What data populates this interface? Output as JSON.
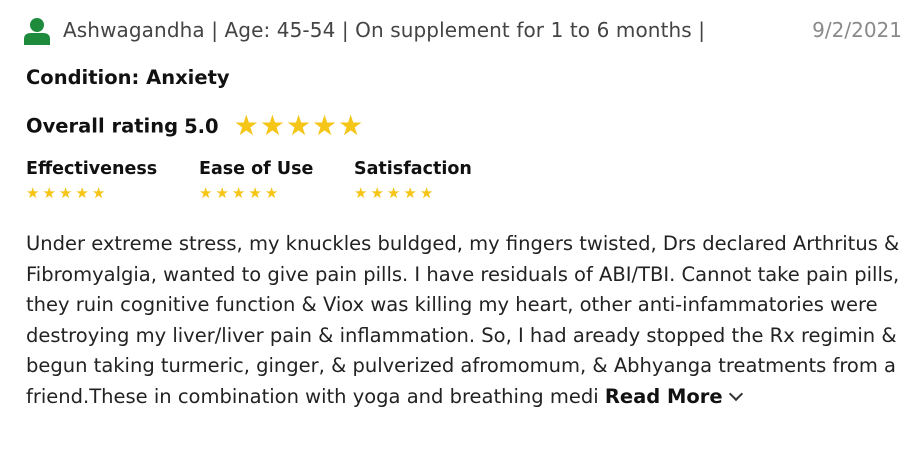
{
  "header": {
    "reviewer_meta": "Ashwagandha | Age: 45-54 | On supplement for 1 to 6 months |",
    "date": "9/2/2021",
    "avatar_color": "#1e8a3c"
  },
  "condition": {
    "label": "Condition:",
    "value": "Anxiety"
  },
  "overall": {
    "label": "Overall rating",
    "value": "5.0",
    "stars": 5,
    "star_color": "#f5c518"
  },
  "sub_ratings": [
    {
      "label": "Effectiveness",
      "stars": 5
    },
    {
      "label": "Ease of Use",
      "stars": 5
    },
    {
      "label": "Satisfaction",
      "stars": 5
    }
  ],
  "review": {
    "text": "Under extreme stress, my knuckles buldged, my fingers twisted, Drs declared Arthritus & Fibromyalgia, wanted to give pain pills. I have residuals of ABI/TBI. Cannot take pain pills, they ruin cognitive function & Viox was killing my heart, other anti-infammatories were destroying my liver/liver pain & inflammation. So, I had aready stopped the Rx regimin & begun taking turmeric, ginger, & pulverized afromomum, & Abhyanga treatments from a friend.These in combination with yoga and breathing medi",
    "read_more": "Read More"
  }
}
